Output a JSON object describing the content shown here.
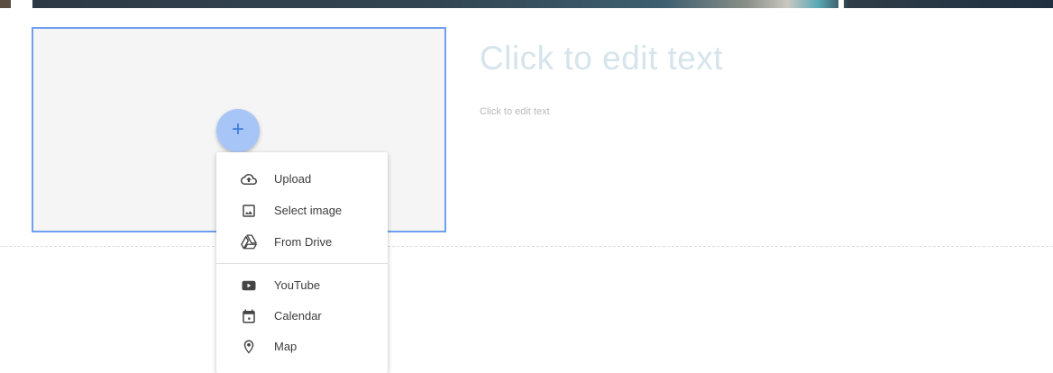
{
  "add_button": {
    "symbol": "+"
  },
  "text_block": {
    "heading": "Click to edit text",
    "body": "Click to edit text"
  },
  "insert_menu": {
    "items": [
      {
        "label": "Upload",
        "icon": "cloud-upload-icon"
      },
      {
        "label": "Select image",
        "icon": "image-icon"
      },
      {
        "label": "From Drive",
        "icon": "google-drive-icon"
      },
      {
        "label": "YouTube",
        "icon": "youtube-icon"
      },
      {
        "label": "Calendar",
        "icon": "calendar-icon"
      },
      {
        "label": "Map",
        "icon": "map-pin-icon"
      }
    ]
  },
  "colors": {
    "accent": "#6f9ff0",
    "add_button_bg": "#a7c5f7",
    "heading": "#d6e4ec"
  }
}
